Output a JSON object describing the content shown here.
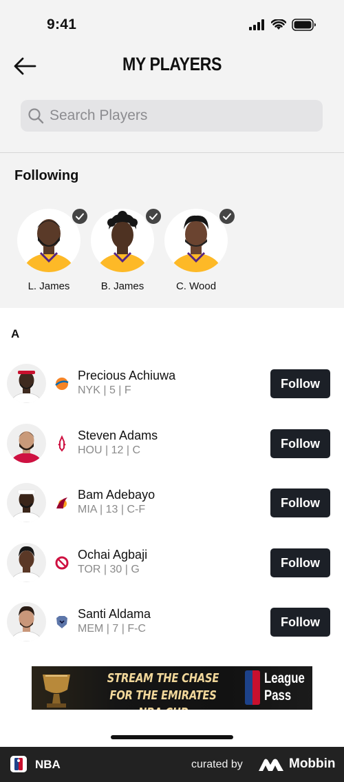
{
  "status_bar": {
    "time": "9:41"
  },
  "header": {
    "title": "MY PLAYERS"
  },
  "search": {
    "placeholder": "Search Players",
    "value": ""
  },
  "following": {
    "heading": "Following",
    "players": [
      {
        "name": "L. James",
        "jersey_color": "#fdb927"
      },
      {
        "name": "B. James",
        "jersey_color": "#fdb927"
      },
      {
        "name": "C. Wood",
        "jersey_color": "#fdb927"
      }
    ]
  },
  "section_letter": "A",
  "players": [
    {
      "name": "Precious Achiuwa",
      "meta": "NYK | 5 | F",
      "team_icon": "knicks-logo-icon",
      "button": "Follow",
      "jersey_color": "#ffffff",
      "logo_color": "#f58426"
    },
    {
      "name": "Steven Adams",
      "meta": "HOU | 12 | C",
      "team_icon": "rockets-logo-icon",
      "button": "Follow",
      "jersey_color": "#ce1141",
      "logo_color": "#ce1141"
    },
    {
      "name": "Bam Adebayo",
      "meta": "MIA | 13 | C-F",
      "team_icon": "heat-logo-icon",
      "button": "Follow",
      "jersey_color": "#ffffff",
      "logo_color": "#98002e"
    },
    {
      "name": "Ochai Agbaji",
      "meta": "TOR | 30 | G",
      "team_icon": "raptors-logo-icon",
      "button": "Follow",
      "jersey_color": "#ffffff",
      "logo_color": "#ce1141"
    },
    {
      "name": "Santi Aldama",
      "meta": "MEM | 7 | F-C",
      "team_icon": "grizzlies-logo-icon",
      "button": "Follow",
      "jersey_color": "#ffffff",
      "logo_color": "#5d76a9"
    }
  ],
  "banner": {
    "line1": "STREAM THE CHASE",
    "line2": "FOR THE EMIRATES NBA CUP",
    "brand_line1": "League",
    "brand_line2": "Pass"
  },
  "footer": {
    "app_name": "NBA",
    "curated_by": "curated by",
    "brand": "Mobbin"
  }
}
